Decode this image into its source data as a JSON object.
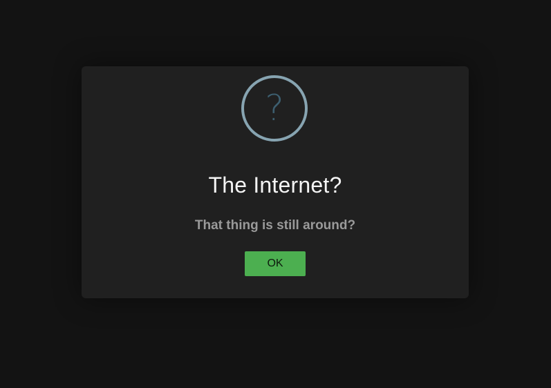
{
  "dialog": {
    "icon": "question-icon",
    "icon_glyph": "?",
    "title": "The Internet?",
    "message": "That thing is still around?",
    "ok_label": "OK"
  },
  "colors": {
    "background": "#131313",
    "dialog_background": "#202020",
    "icon_ring": "#87a4b1",
    "icon_glyph": "#3d5f70",
    "title": "#f4f4f4",
    "message": "#9a9a9a",
    "ok_button": "#4caf50"
  }
}
